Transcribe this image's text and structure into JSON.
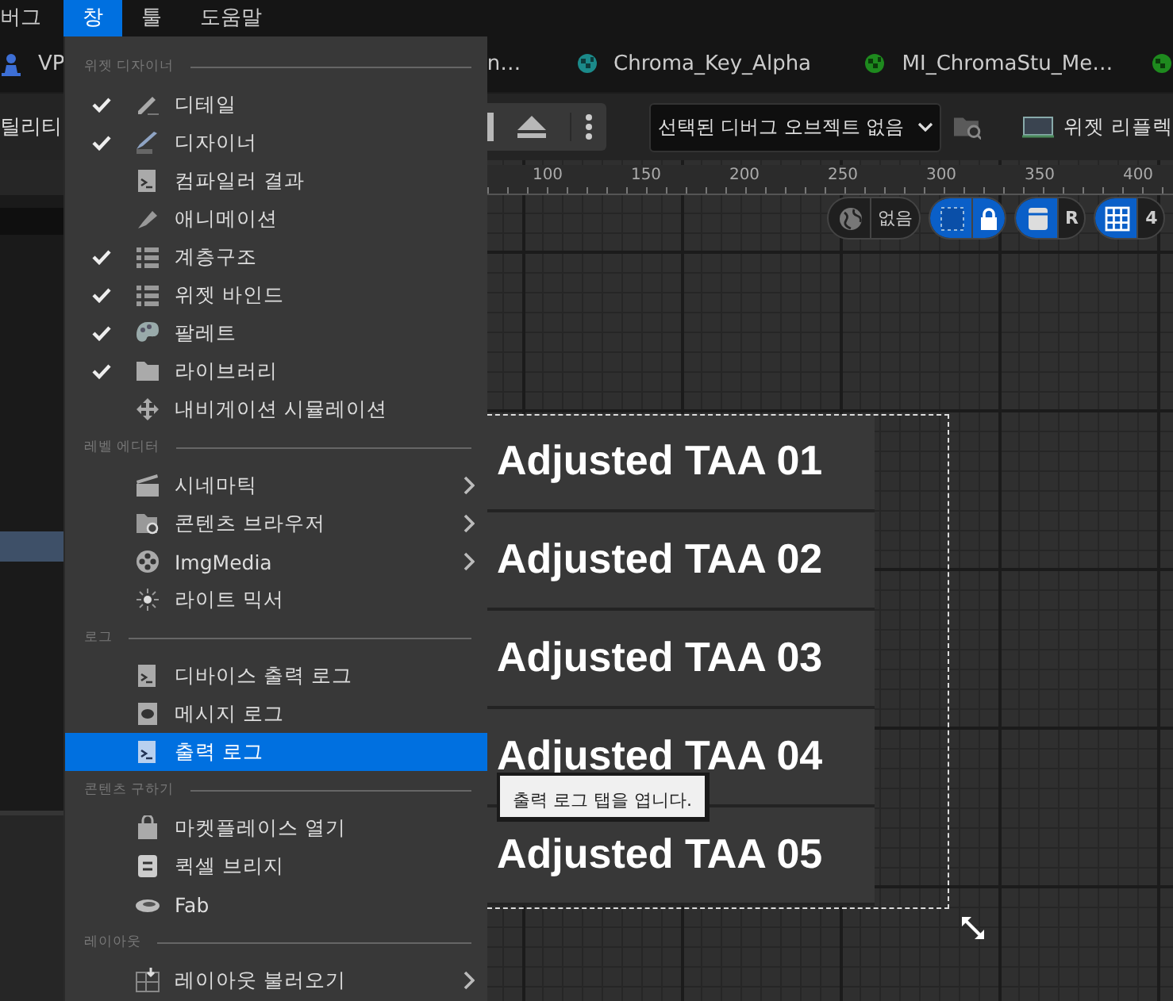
{
  "menubar": {
    "items": [
      {
        "label": "버그",
        "selected": false
      },
      {
        "label": "창",
        "selected": true
      },
      {
        "label": "툴",
        "selected": false
      },
      {
        "label": "도움말",
        "selected": false
      }
    ]
  },
  "document_tabs": [
    {
      "label": "VP"
    },
    {
      "label": "n…"
    },
    {
      "label": "Chroma_Key_Alpha"
    },
    {
      "label": "MI_ChromaStu_Me…"
    }
  ],
  "toolbar": {
    "panel_title": "틸리티",
    "debug_dropdown": "선택된 디버그 오브젝트 없음",
    "widget_reflector": "위젯 리플렉"
  },
  "ruler": {
    "ticks": [
      "100",
      "150",
      "200",
      "250",
      "300",
      "350",
      "400"
    ]
  },
  "viewport_controls": [
    {
      "kind": "globe",
      "on": false,
      "label": "없음"
    },
    {
      "kind": "lock",
      "on": true
    },
    {
      "kind": "respect",
      "on": true,
      "label": "R"
    },
    {
      "kind": "grid",
      "on": true,
      "label": "4"
    }
  ],
  "widgets": [
    "Adjusted TAA 01",
    "Adjusted TAA 02",
    "Adjusted TAA 03",
    "Adjusted TAA 04",
    "Adjusted TAA 05"
  ],
  "menu": {
    "sections": [
      {
        "header": "위젯 디자이너",
        "items": [
          {
            "label": "디테일",
            "checked": true,
            "submenu": false,
            "selected": false
          },
          {
            "label": "디자이너",
            "checked": true,
            "submenu": false,
            "selected": false
          },
          {
            "label": "컴파일러 결과",
            "checked": false,
            "submenu": false,
            "selected": false
          },
          {
            "label": "애니메이션",
            "checked": false,
            "submenu": false,
            "selected": false
          },
          {
            "label": "계층구조",
            "checked": true,
            "submenu": false,
            "selected": false
          },
          {
            "label": "위젯 바인드",
            "checked": true,
            "submenu": false,
            "selected": false
          },
          {
            "label": "팔레트",
            "checked": true,
            "submenu": false,
            "selected": false
          },
          {
            "label": "라이브러리",
            "checked": true,
            "submenu": false,
            "selected": false
          },
          {
            "label": "내비게이션 시뮬레이션",
            "checked": false,
            "submenu": false,
            "selected": false
          }
        ]
      },
      {
        "header": "레벨 에디터",
        "items": [
          {
            "label": "시네마틱",
            "checked": false,
            "submenu": true,
            "selected": false
          },
          {
            "label": "콘텐츠 브라우저",
            "checked": false,
            "submenu": true,
            "selected": false
          },
          {
            "label": "ImgMedia",
            "checked": false,
            "submenu": true,
            "selected": false
          },
          {
            "label": "라이트 믹서",
            "checked": false,
            "submenu": false,
            "selected": false
          }
        ]
      },
      {
        "header": "로그",
        "items": [
          {
            "label": "디바이스 출력 로그",
            "checked": false,
            "submenu": false,
            "selected": false
          },
          {
            "label": "메시지 로그",
            "checked": false,
            "submenu": false,
            "selected": false
          },
          {
            "label": "출력 로그",
            "checked": false,
            "submenu": false,
            "selected": true
          }
        ]
      },
      {
        "header": "콘텐츠 구하기",
        "items": [
          {
            "label": "마켓플레이스 열기",
            "checked": false,
            "submenu": false,
            "selected": false
          },
          {
            "label": "퀵셀 브리지",
            "checked": false,
            "submenu": false,
            "selected": false
          },
          {
            "label": "Fab",
            "checked": false,
            "submenu": false,
            "selected": false
          }
        ]
      },
      {
        "header": "레이아웃",
        "items": [
          {
            "label": "레이아웃 불러오기",
            "checked": false,
            "submenu": true,
            "selected": false
          }
        ]
      }
    ]
  },
  "tooltip": "출력 로그 탭을 엽니다."
}
